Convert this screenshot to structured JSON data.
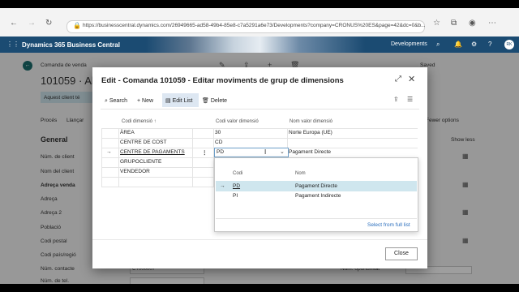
{
  "browser": {
    "url": "https://businesscentral.dynamics.com/26949665-ad58-49b4-85e8-c7a5291a6e73/Developments?company=CRONUS%20ES&page=42&dc=0&b..."
  },
  "appbar": {
    "app_name": "Dynamics 365 Business Central",
    "environment": "Developments",
    "avatar_initials": "RK"
  },
  "background_page": {
    "breadcrumb": "Comanda de venda",
    "record_title": "101059 · Al",
    "saved": "Saved",
    "banner_text": "Aquest client té",
    "actions": [
      "Procés",
      "Llançar"
    ],
    "fewer_options": "Fewer options",
    "section_title": "General",
    "show_less": "Show less",
    "fields": [
      "Núm. de client",
      "Nom del client",
      "Adreça venda",
      "Adreça",
      "Adreça 2",
      "Població",
      "Codi postal",
      "Codi país/regió",
      "Núm. contacte",
      "Núm. de tel."
    ],
    "right_field": "Núm. oportunitat",
    "contact_value": "CT000007"
  },
  "dialog": {
    "title": "Edit - Comanda 101059 - Editar moviments de grup de dimensions",
    "toolbar": {
      "search": "Search",
      "new": "New",
      "edit_list": "Edit List",
      "delete": "Delete"
    },
    "columns": {
      "dimension_code": "Codi dimensió ↑",
      "dimension_value_code": "Codi valor dimensió",
      "dimension_value_name": "Nom valor dimensió"
    },
    "rows": [
      {
        "code": "ÀREA",
        "value": "30",
        "name": "Norte Europa (UE)"
      },
      {
        "code": "CENTRE DE COST",
        "value": "CD",
        "name": ""
      },
      {
        "code": "CENTRE DE PAGAMENTS",
        "value": "PD",
        "name": "Pagament Directe"
      },
      {
        "code": "GRUPOCLIENTE",
        "value": "",
        "name": ""
      },
      {
        "code": "VENDEDOR",
        "value": "",
        "name": ""
      }
    ],
    "dropdown": {
      "col_code": "Codi",
      "col_name": "Nom",
      "options": [
        {
          "code": "PD",
          "name": "Pagament Directe"
        },
        {
          "code": "PI",
          "name": "Pagament Indirecte"
        }
      ],
      "select_full_list": "Select from full list"
    },
    "close": "Close"
  }
}
